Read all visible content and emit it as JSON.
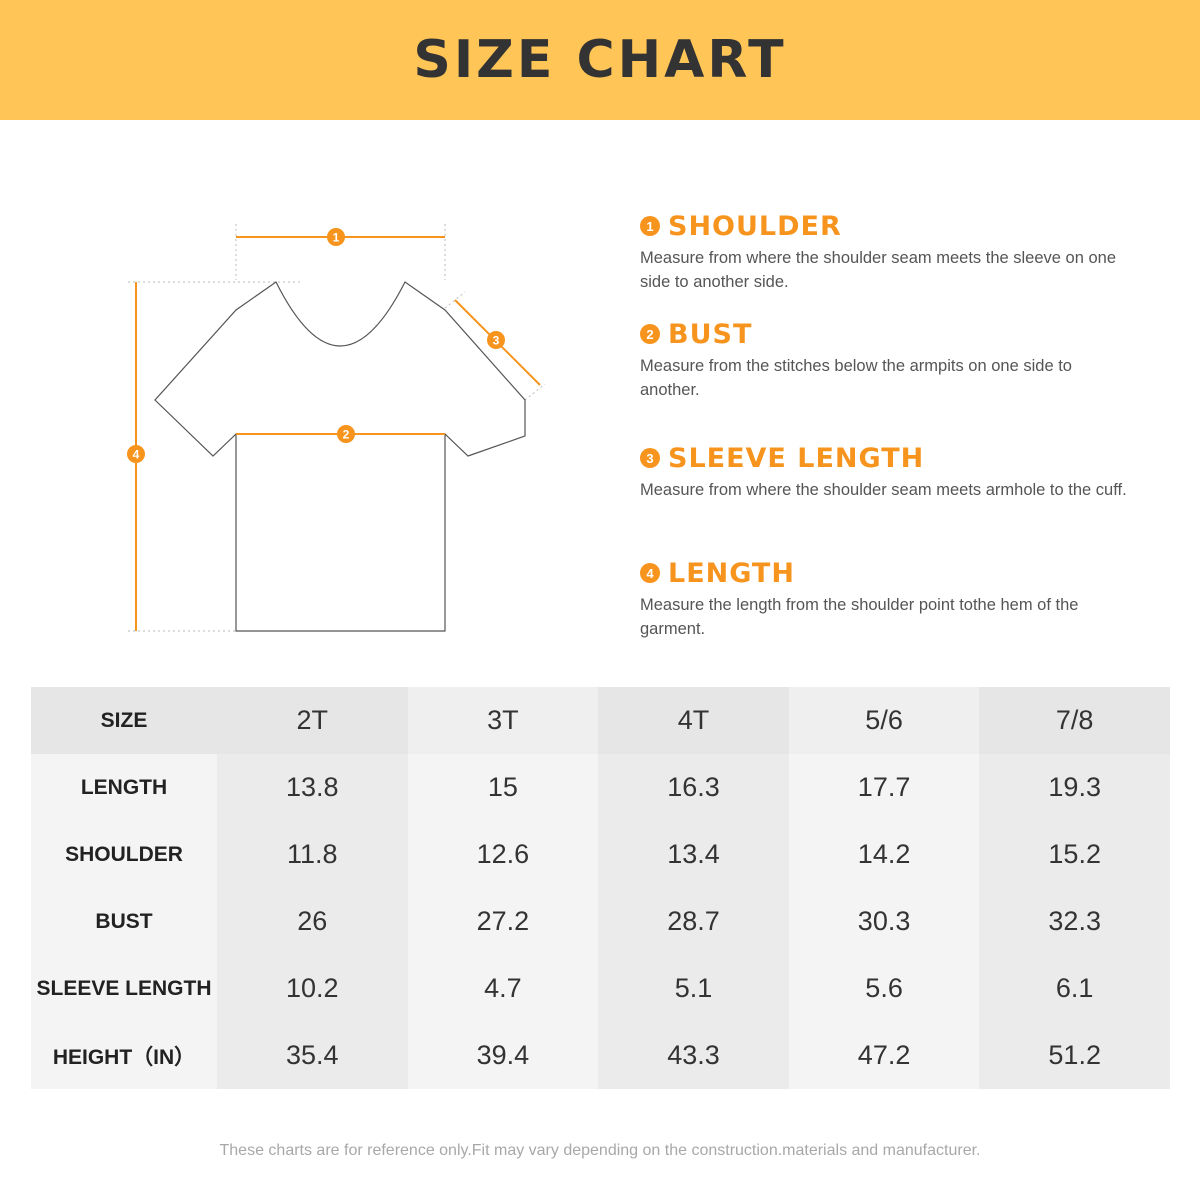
{
  "header": {
    "title": "SIZE CHART"
  },
  "colors": {
    "banner": "#ffc557",
    "accent": "#f7941d",
    "text": "#333333"
  },
  "diagram": {
    "markers": [
      "1",
      "2",
      "3",
      "4"
    ]
  },
  "definitions": [
    {
      "number": "1",
      "title": "SHOULDER",
      "text": "Measure from where the shoulder seam meets the sleeve on one side to another side."
    },
    {
      "number": "2",
      "title": "BUST",
      "text": "Measure from the stitches below the armpits on one side to another."
    },
    {
      "number": "3",
      "title": "SLEEVE LENGTH",
      "text": "Measure from where the shoulder seam meets armhole to the cuff."
    },
    {
      "number": "4",
      "title": "LENGTH",
      "text": "Measure the length from the shoulder point tothe hem of the garment."
    }
  ],
  "table": {
    "header": {
      "label": "SIZE",
      "sizes": [
        "2T",
        "3T",
        "4T",
        "5/6",
        "7/8"
      ]
    },
    "rows": [
      {
        "label": "LENGTH",
        "values": [
          "13.8",
          "15",
          "16.3",
          "17.7",
          "19.3"
        ]
      },
      {
        "label": "SHOULDER",
        "values": [
          "11.8",
          "12.6",
          "13.4",
          "14.2",
          "15.2"
        ]
      },
      {
        "label": "BUST",
        "values": [
          "26",
          "27.2",
          "28.7",
          "30.3",
          "32.3"
        ]
      },
      {
        "label": "SLEEVE LENGTH",
        "values": [
          "10.2",
          "4.7",
          "5.1",
          "5.6",
          "6.1"
        ]
      },
      {
        "label": "HEIGHT（IN）",
        "values": [
          "35.4",
          "39.4",
          "43.3",
          "47.2",
          "51.2"
        ]
      }
    ]
  },
  "footnote": "These charts are for reference only.Fit may vary depending on the construction.materials and manufacturer."
}
